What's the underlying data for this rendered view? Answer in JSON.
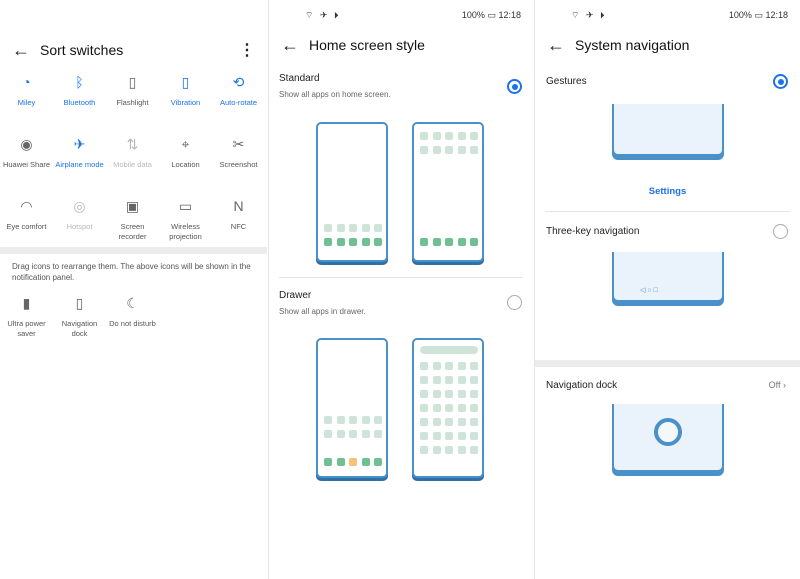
{
  "status": {
    "left_icons": "⌔ ✈ ⏵",
    "battery_text": "100%",
    "time": "12:18"
  },
  "sort_switches": {
    "title": "Sort switches",
    "switches": [
      {
        "label": "Miley",
        "icon": "wifi-icon",
        "glyph": "◔",
        "state": "on"
      },
      {
        "label": "Bluetooth",
        "icon": "bluetooth-icon",
        "glyph": "ᛒ",
        "state": "on"
      },
      {
        "label": "Flashlight",
        "icon": "flashlight-icon",
        "glyph": "▯",
        "state": "off"
      },
      {
        "label": "Vibration",
        "icon": "vibration-icon",
        "glyph": "▯",
        "state": "on"
      },
      {
        "label": "Auto-rotate",
        "icon": "auto-rotate-icon",
        "glyph": "⟲",
        "state": "on"
      },
      {
        "label": "Huawei Share",
        "icon": "huawei-share-icon",
        "glyph": "◉",
        "state": "off"
      },
      {
        "label": "Airplane mode",
        "icon": "airplane-icon",
        "glyph": "✈",
        "state": "on"
      },
      {
        "label": "Mobile data",
        "icon": "mobile-data-icon",
        "glyph": "⇅",
        "state": "disabled"
      },
      {
        "label": "Location",
        "icon": "location-icon",
        "glyph": "⌖",
        "state": "off"
      },
      {
        "label": "Screenshot",
        "icon": "screenshot-icon",
        "glyph": "✂",
        "state": "off"
      },
      {
        "label": "Eye comfort",
        "icon": "eye-comfort-icon",
        "glyph": "◠",
        "state": "off"
      },
      {
        "label": "Hotspot",
        "icon": "hotspot-icon",
        "glyph": "◎",
        "state": "disabled"
      },
      {
        "label": "Screen recorder",
        "icon": "screen-recorder-icon",
        "glyph": "▣",
        "state": "off"
      },
      {
        "label": "Wireless projection",
        "icon": "wireless-projection-icon",
        "glyph": "▭",
        "state": "off"
      },
      {
        "label": "NFC",
        "icon": "nfc-icon",
        "glyph": "N",
        "state": "off"
      }
    ],
    "hint": "Drag icons to rearrange them. The above icons will be shown in the notification panel.",
    "extra": [
      {
        "label": "Ultra power saver",
        "icon": "ultra-power-saver-icon",
        "glyph": "▮"
      },
      {
        "label": "Navigation dock",
        "icon": "navigation-dock-icon",
        "glyph": "▯"
      },
      {
        "label": "Do not disturb",
        "icon": "do-not-disturb-icon",
        "glyph": "☾"
      }
    ]
  },
  "home_style": {
    "title": "Home screen style",
    "standard_title": "Standard",
    "standard_sub": "Show all apps on home screen.",
    "drawer_title": "Drawer",
    "drawer_sub": "Show all apps in drawer.",
    "selected": "Standard"
  },
  "system_nav": {
    "title": "System navigation",
    "gestures": "Gestures",
    "settings": "Settings",
    "three_key": "Three-key navigation",
    "nav_keys": "◁   ○   □",
    "dock": "Navigation dock",
    "dock_value": "Off",
    "selected": "Gestures"
  },
  "colors": {
    "accent": "#1a73e8",
    "illustration": "#4a90c9",
    "app_green": "#6fc193",
    "app_light": "#cfe4d8"
  }
}
